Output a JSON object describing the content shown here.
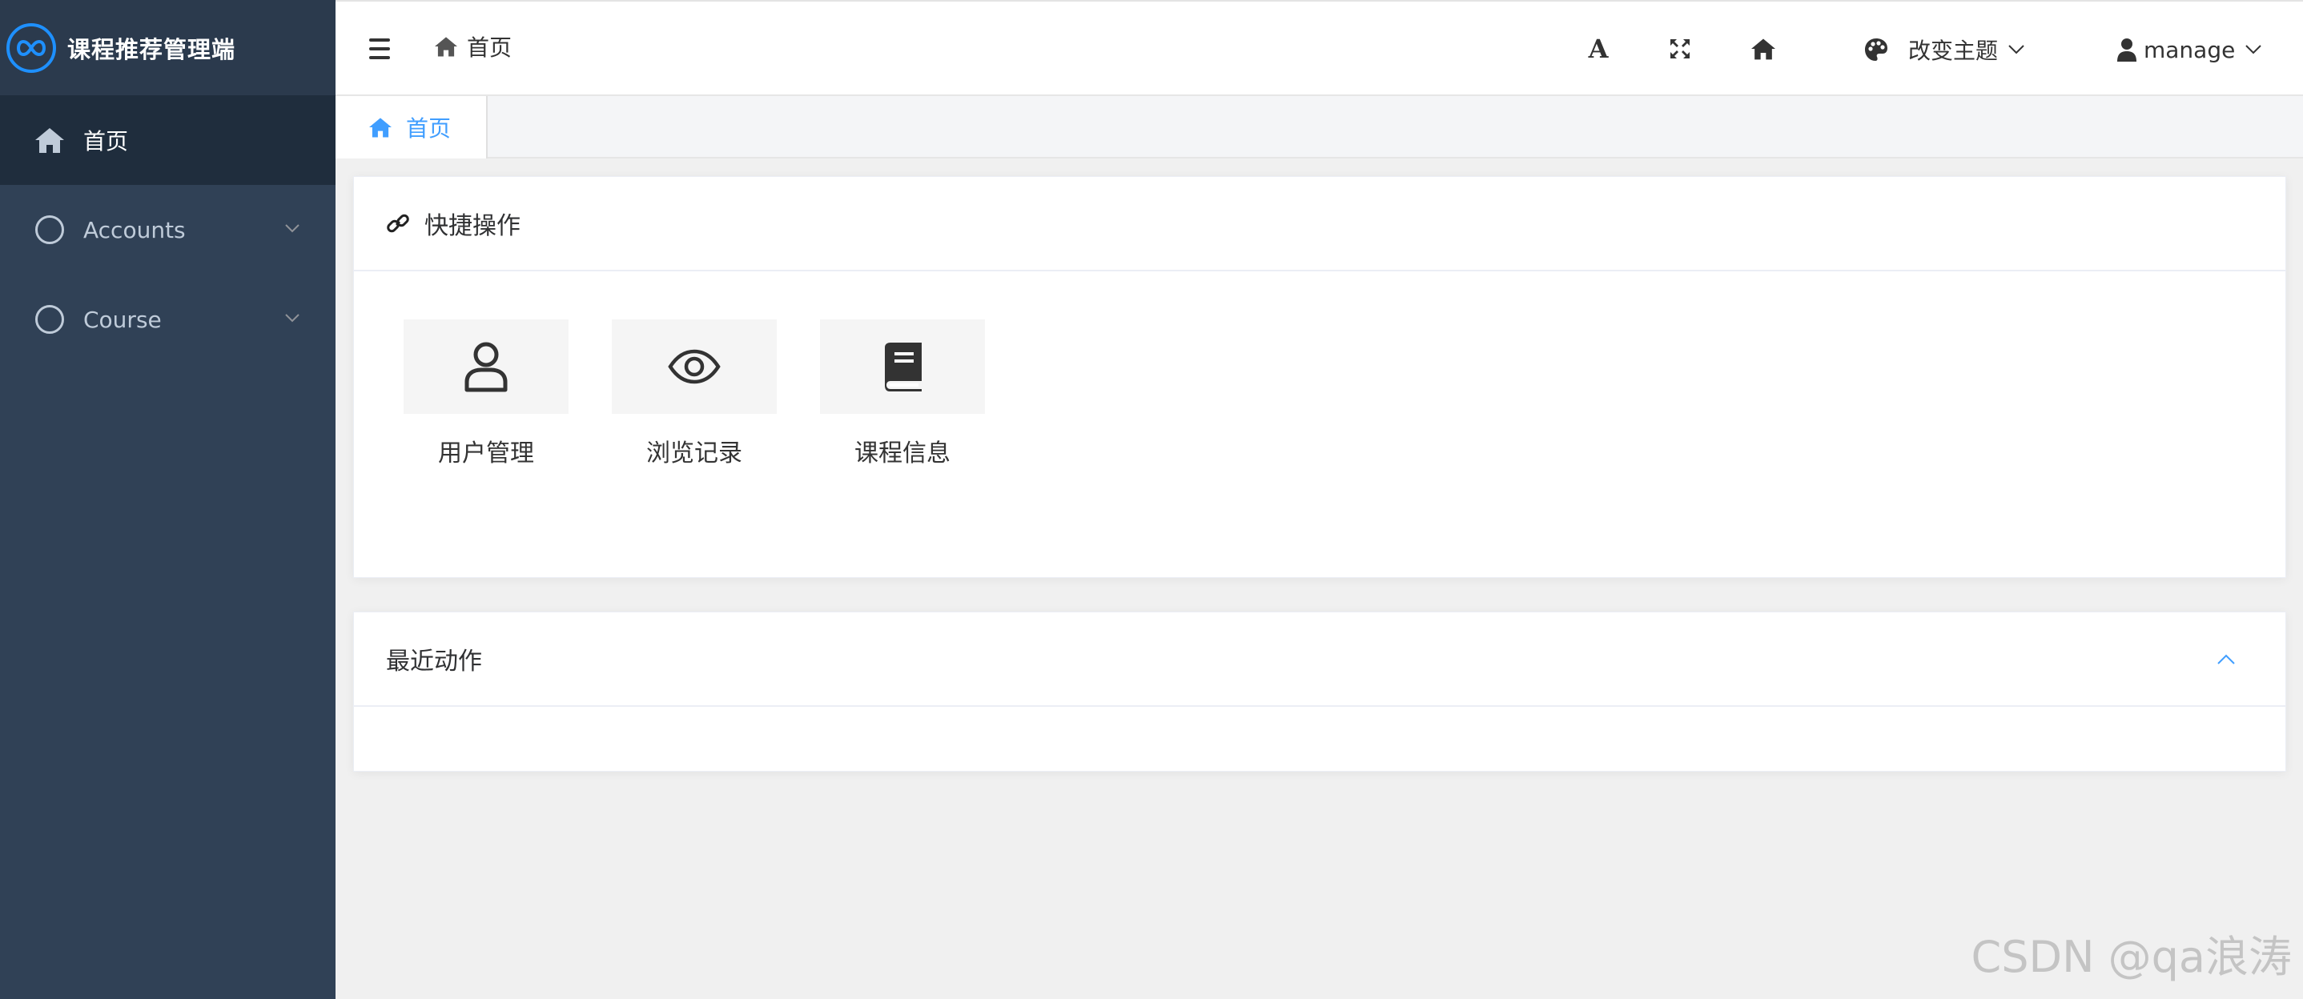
{
  "app": {
    "title": "课程推荐管理端"
  },
  "sidebar": {
    "items": [
      {
        "label": "首页",
        "icon": "home-icon",
        "active": true
      },
      {
        "label": "Accounts",
        "icon": "circle-icon",
        "expandable": true
      },
      {
        "label": "Course",
        "icon": "circle-icon",
        "expandable": true
      }
    ]
  },
  "navbar": {
    "breadcrumb": "首页",
    "theme_label": "改变主题",
    "user_label": "manage"
  },
  "tags": {
    "active_tag": "首页"
  },
  "quick_actions": {
    "title": "快捷操作",
    "items": [
      {
        "label": "用户管理",
        "icon": "user-icon"
      },
      {
        "label": "浏览记录",
        "icon": "eye-icon"
      },
      {
        "label": "课程信息",
        "icon": "book-icon"
      }
    ]
  },
  "recent": {
    "title": "最近动作"
  },
  "watermark": "CSDN @qa浪涛",
  "colors": {
    "sidebar_bg": "#304156",
    "sidebar_active": "#1f2d3d",
    "accent": "#409eff"
  }
}
